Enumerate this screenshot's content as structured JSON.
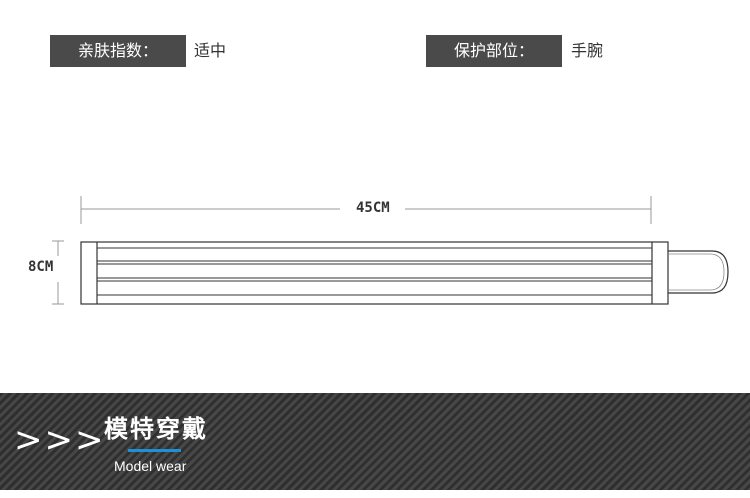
{
  "specs": {
    "skin_label": "亲肤指数：",
    "skin_value": "适中",
    "position_label": "保护部位：",
    "position_value": "手腕"
  },
  "dimensions": {
    "length": "45CM",
    "width": "8CM"
  },
  "banner": {
    "arrows": ">>>",
    "title": "模特穿戴",
    "subtitle": "Model wear",
    "accent_color": "#1e90d8"
  }
}
